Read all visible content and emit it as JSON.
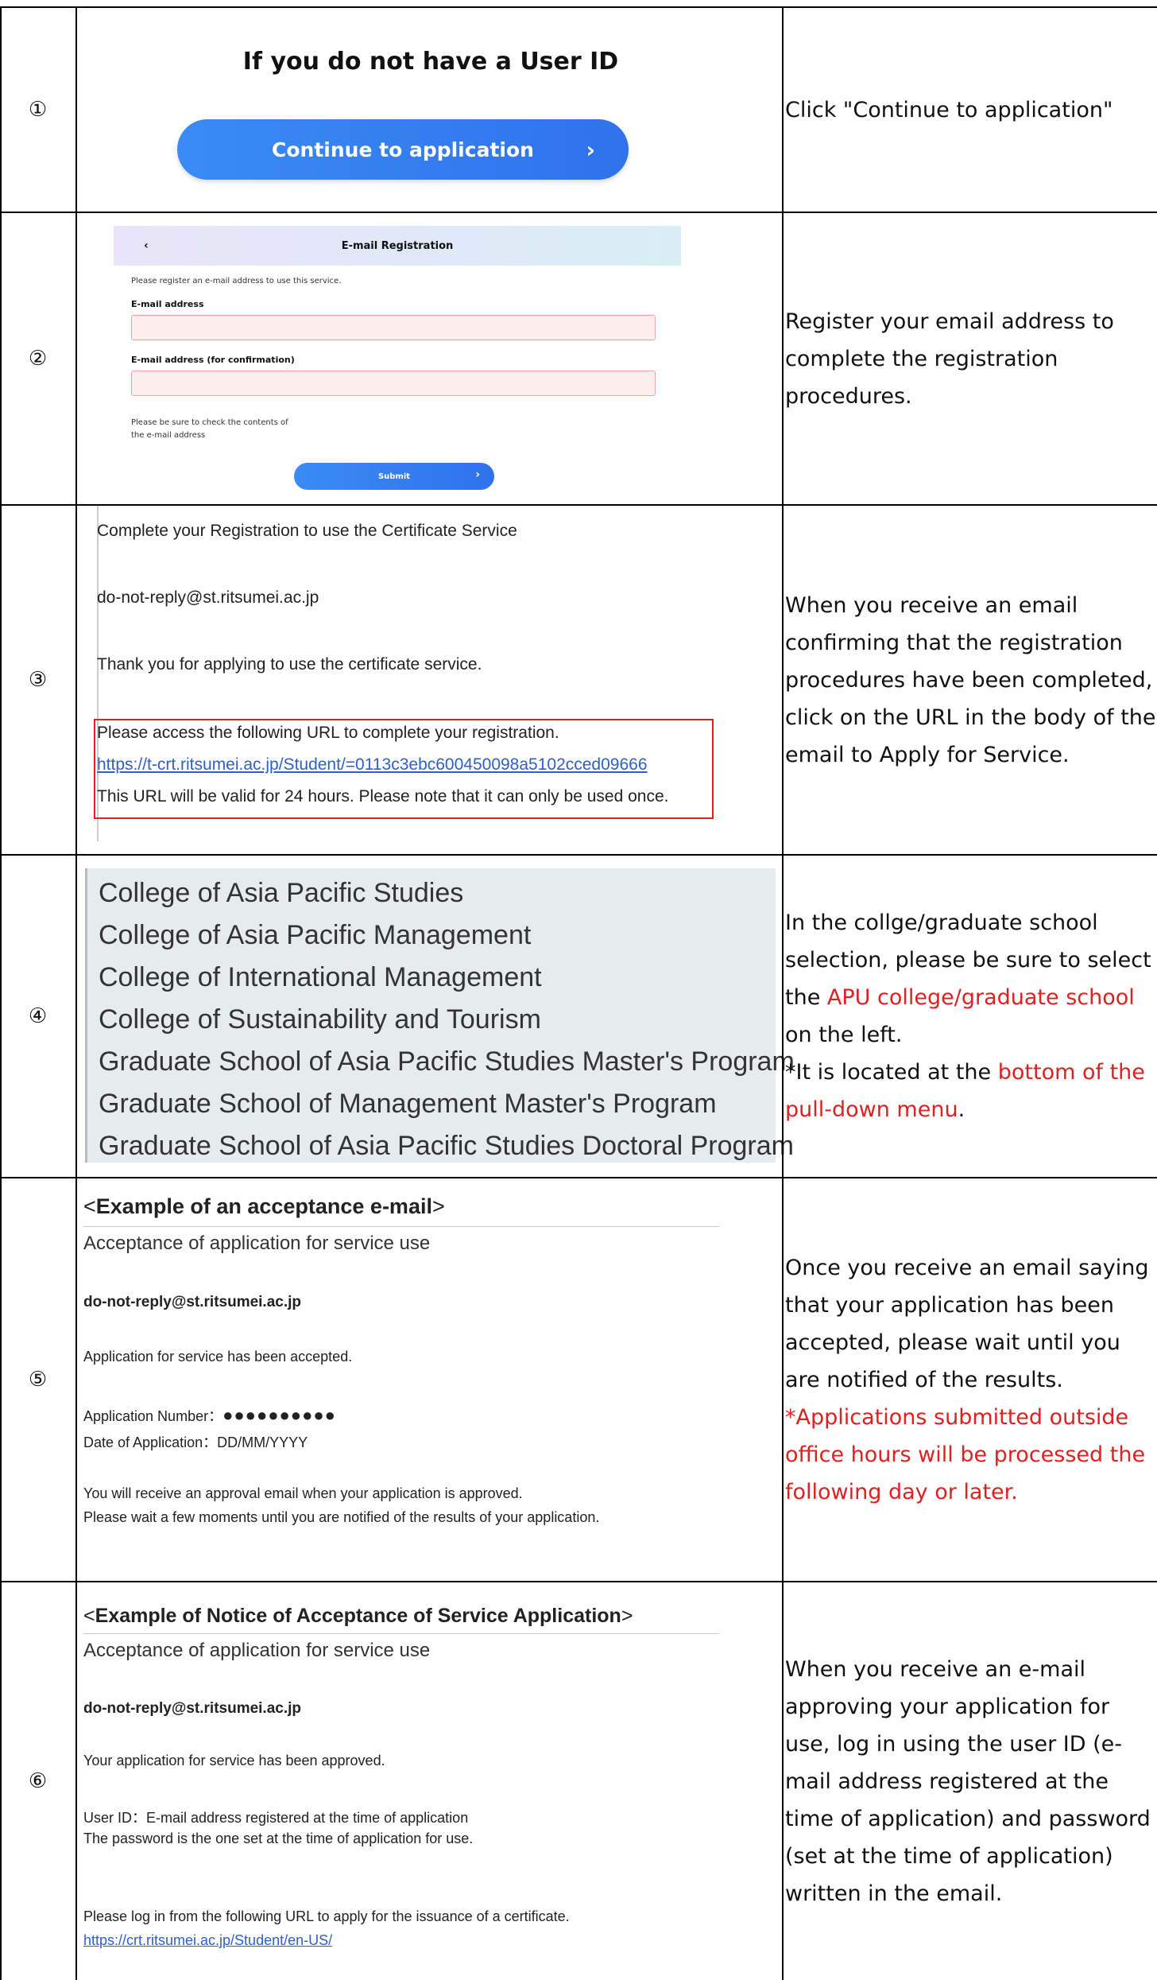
{
  "rows": [
    {
      "num": "①",
      "title": "If you do not have a User ID",
      "button": "Continue to application",
      "chevron": "›",
      "desc": "Click \"Continue to application\""
    },
    {
      "num": "②",
      "header": "E-mail Registration",
      "back": "‹",
      "intro": "Please register an e-mail address to use this service.",
      "label1": "E-mail address",
      "label2": "E-mail address (for confirmation)",
      "note1": "Please be sure to check the contents of",
      "note2": "the e-mail address",
      "submit": "Submit",
      "chevron": "›",
      "desc": "Register your email address to complete the registration procedures."
    },
    {
      "num": "③",
      "subject": "Complete your Registration to use the Certificate Service",
      "sender": "do-not-reply@st.ritsumei.ac.jp",
      "thanks": "Thank you for applying to use the certificate service.",
      "access": "Please access the following URL to complete your registration.",
      "url": "https://t-crt.ritsumei.ac.jp/Student/=0113c3ebc600450098a5102cced09666",
      "valid": "This URL will be valid for 24 hours. Please note that it can only be used once.",
      "desc": "When you receive an email confirming that the registration procedures have been completed, click on the URL in the body of the email to Apply for Service."
    },
    {
      "num": "④",
      "colleges": [
        "College of Asia Pacific Studies",
        "College of Asia Pacific Management",
        "College of International Management",
        "College of Sustainability and Tourism",
        "Graduate School of Asia Pacific Studies Master's Program",
        "Graduate School of Management Master's Program",
        "Graduate School of Asia Pacific Studies Doctoral Program"
      ],
      "desc_a": "In the collge/graduate school selection, please be sure to select the ",
      "desc_red1": "APU college/graduate school",
      "desc_b": " on the left.\n*It is located at the ",
      "desc_red2": "bottom of the pull-down menu",
      "desc_c": "."
    },
    {
      "num": "⑤",
      "heading_pre": "<",
      "heading": "Example of an acceptance e-mail",
      "heading_post": ">",
      "subject": "Acceptance of application for service use",
      "sender": "do-not-reply@st.ritsumei.ac.jp",
      "accepted": "Application for service has been accepted.",
      "app_number_label": "Application Number：",
      "app_number_value": "●●●●●●●●●●",
      "date_label": "Date of Application：DD/MM/YYYY",
      "approval": "You will receive an approval email when your application is approved.",
      "wait": "Please wait a few moments until you are notified of the results of your application.",
      "desc": "Once you receive an email saying that your application has been accepted, please wait until you are notified of the results.",
      "desc_red": "*Applications submitted outside office hours will be processed the following day or later."
    },
    {
      "num": "⑥",
      "heading_pre": "<",
      "heading": "Example of Notice of Acceptance of Service Application",
      "heading_post": ">",
      "subject": "Acceptance of application for service use",
      "sender": "do-not-reply@st.ritsumei.ac.jp",
      "approved": "Your application for service has been approved.",
      "userid": "User ID：E-mail address registered at the time of application",
      "password": "The password is the one set at the time of application for use.",
      "login": "Please log in from the following URL to apply for the issuance of a certificate.",
      "url": "https://crt.ritsumei.ac.jp/Student/en-US/",
      "desc": "When you receive an e-mail approving your application for use, log in using the user ID (e-mail address registered at the time of application) and password (set at the time of application) written in the email."
    }
  ],
  "colors": {
    "accent_blue": "#2f72ec",
    "red": "#e02020",
    "link": "#2f5fc8"
  }
}
